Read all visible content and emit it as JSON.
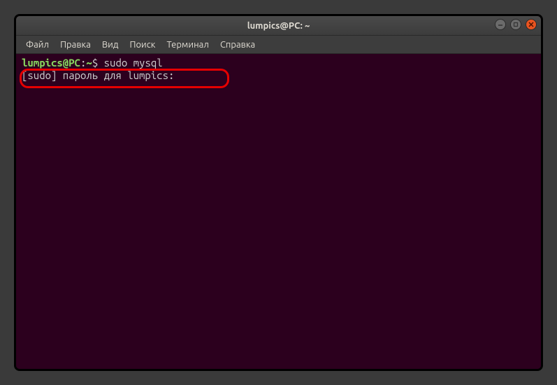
{
  "window": {
    "title": "lumpics@PC: ~"
  },
  "menu": {
    "file": "Файл",
    "edit": "Правка",
    "view": "Вид",
    "search": "Поиск",
    "terminal": "Терминал",
    "help": "Справка"
  },
  "terminal": {
    "prompt_user": "lumpics@PC",
    "prompt_colon": ":",
    "prompt_path": "~",
    "prompt_dollar": "$",
    "command": "sudo mysql",
    "sudo_prompt": "[sudo] пароль для lumpics:"
  },
  "icons": {
    "minimize": "minimize-icon",
    "maximize": "maximize-icon",
    "close": "close-icon"
  }
}
